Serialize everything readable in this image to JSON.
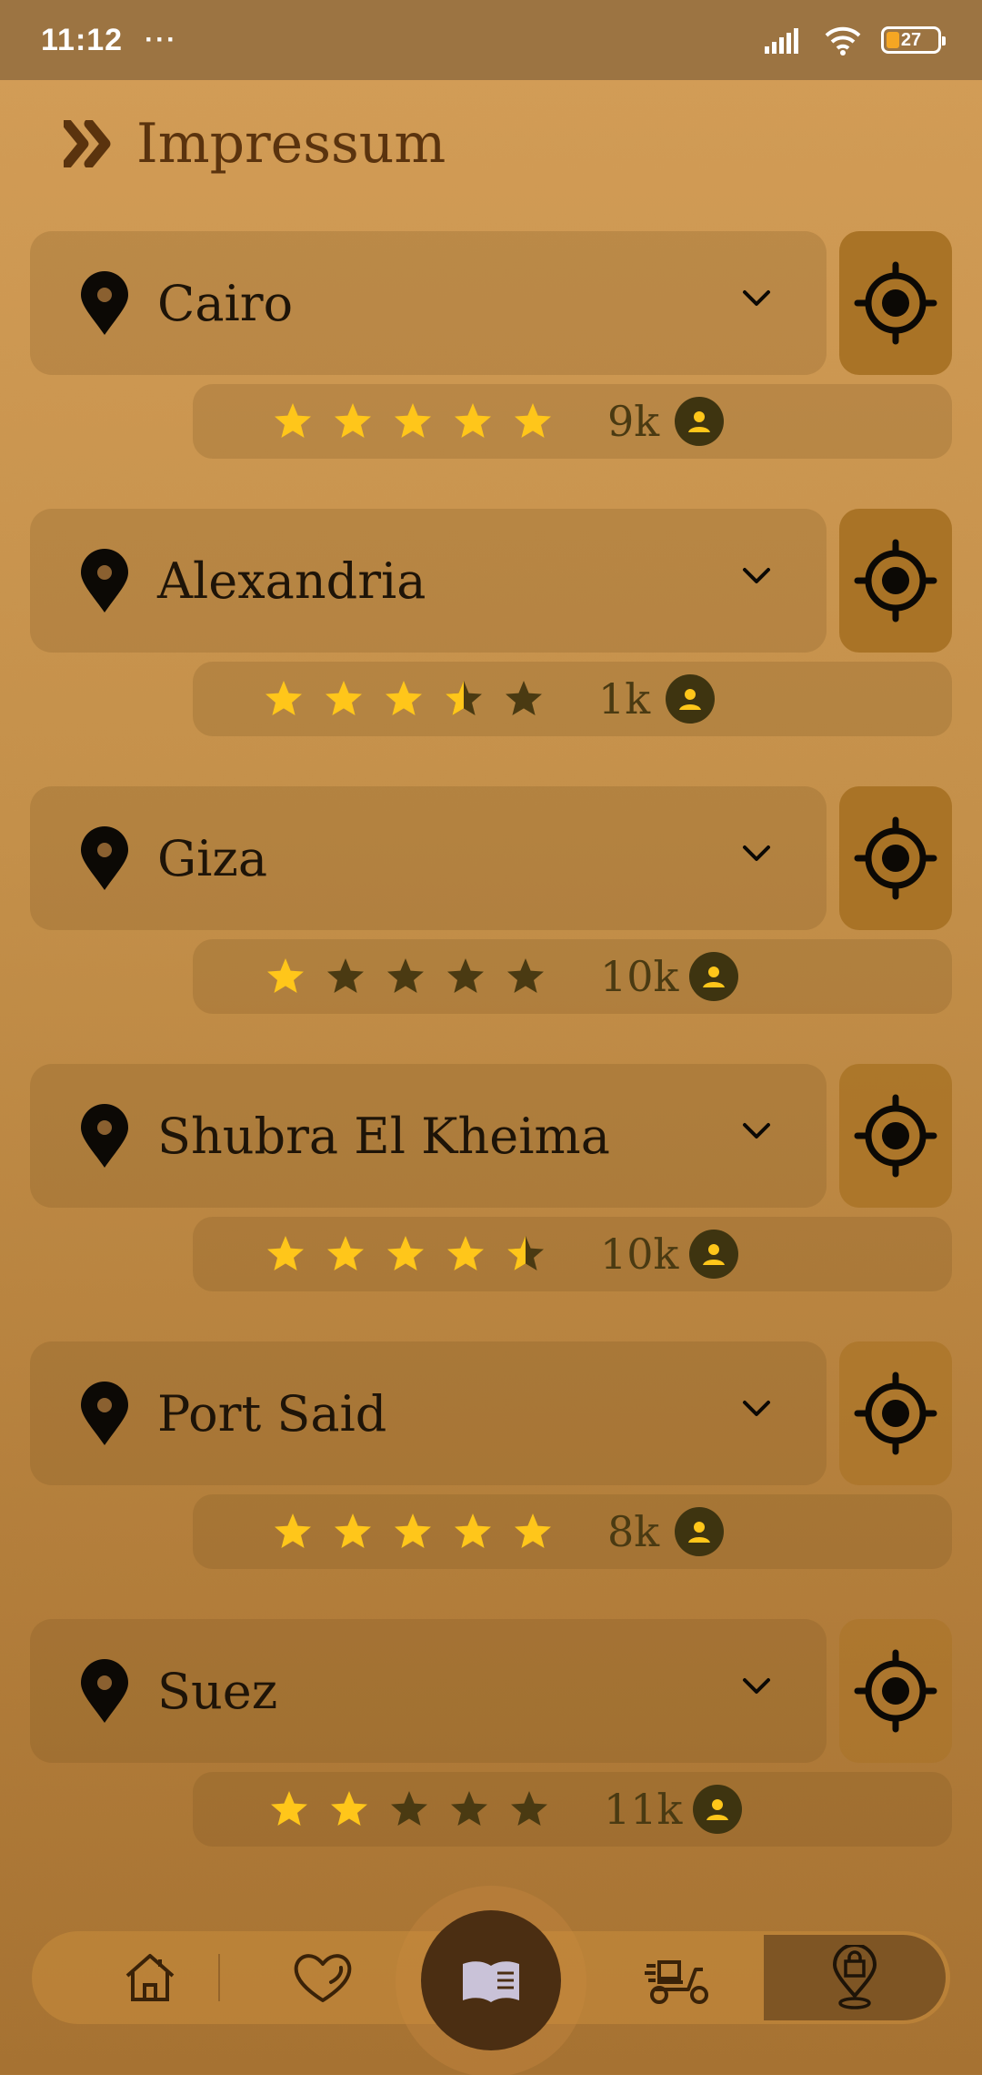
{
  "status_bar": {
    "time": "11:12",
    "dots": "···",
    "battery": "27"
  },
  "header": {
    "title": "Impressum",
    "icon": "double-chevron-right-icon"
  },
  "cities": [
    {
      "name": "Cairo",
      "rating": 5,
      "count": "9k"
    },
    {
      "name": "Alexandria",
      "rating": 3.5,
      "count": "1k"
    },
    {
      "name": "Giza",
      "rating": 1,
      "count": "10k"
    },
    {
      "name": "Shubra El Kheima",
      "rating": 4.5,
      "count": "10k"
    },
    {
      "name": "Port Said",
      "rating": 5,
      "count": "8k"
    },
    {
      "name": "Suez",
      "rating": 2,
      "count": "11k"
    }
  ],
  "nav": {
    "items": [
      "home-icon",
      "heart-icon",
      "book-icon",
      "delivery-scooter-icon",
      "location-bag-icon"
    ],
    "active": "location-bag-icon"
  },
  "colors": {
    "accent_dark": "#5A330E",
    "star_filled": "#FFC61A",
    "star_empty": "#4A3A12",
    "locate_bg": "#A97326"
  }
}
